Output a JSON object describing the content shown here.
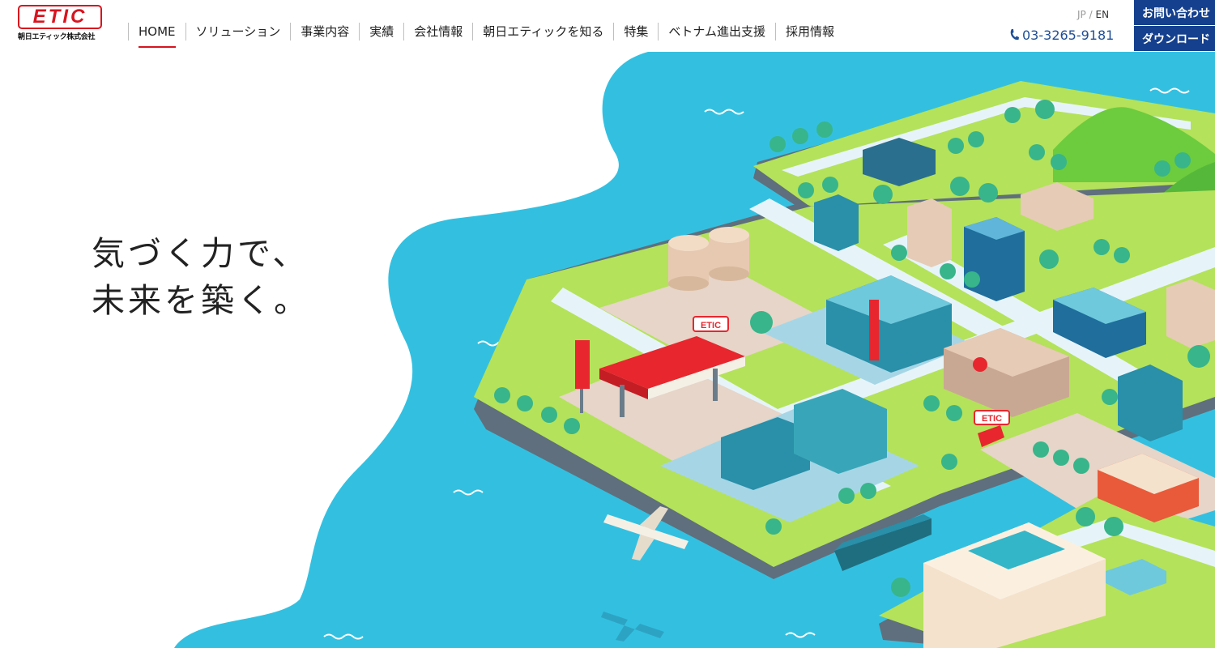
{
  "logo": {
    "mark": "ETIC",
    "company": "朝日エティック株式会社"
  },
  "nav": {
    "items": [
      "HOME",
      "ソリューション",
      "事業内容",
      "実績",
      "会社情報",
      "朝日エティックを知る",
      "特集",
      "ベトナム進出支援",
      "採用情報"
    ]
  },
  "lang": {
    "jp": "JP",
    "separator": "/",
    "en": "EN"
  },
  "phone": {
    "number": "03-3265-9181",
    "icon": "phone-icon"
  },
  "buttons": {
    "contact": "お問い合わせ",
    "download": "ダウンロード"
  },
  "hero": {
    "line1": "気づく力で、",
    "line2": "未来を築く。",
    "sign_label": "ETIC",
    "truck_label": "ETIC"
  },
  "colors": {
    "brand_red": "#d8141f",
    "brand_blue": "#15408e",
    "sea": "#33c0e0",
    "land": "#b4e25a",
    "road": "#e6f4fa"
  }
}
